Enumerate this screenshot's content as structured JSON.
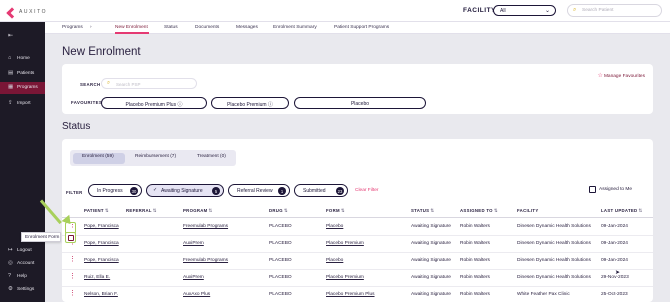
{
  "app": {
    "logo_text": "AUXITO"
  },
  "header": {
    "facility_label": "FACILITY",
    "facility_value": "All",
    "search_placeholder": "Search Patient"
  },
  "sidebar": {
    "items": [
      {
        "label": "Home",
        "icon": "home-icon"
      },
      {
        "label": "Patients",
        "icon": "patients-icon"
      },
      {
        "label": "Programs",
        "icon": "programs-icon",
        "active": true
      },
      {
        "label": "Import",
        "icon": "import-icon"
      },
      {
        "label": "Logout",
        "icon": "logout-icon"
      },
      {
        "label": "Account",
        "icon": "account-icon"
      },
      {
        "label": "Help",
        "icon": "help-icon"
      },
      {
        "label": "Settings",
        "icon": "settings-icon"
      }
    ]
  },
  "subnav": {
    "tabs": [
      "Programs",
      "New Enrolment",
      "Status",
      "Documents",
      "Messages",
      "Enrolment Summary",
      "Patient Support Programs"
    ],
    "active": "New Enrolment"
  },
  "new_enrolment": {
    "title": "New Enrolment",
    "manage_favourites": "Manage Favourites",
    "search_label": "SEARCH",
    "search_placeholder": "Search PSP",
    "favourites_label": "FAVOURITES",
    "favourites": [
      "Placebo Premium Plus",
      "Placebo Premium",
      "Placebo"
    ]
  },
  "status": {
    "title": "Status",
    "segments": [
      "Enrolment (59)",
      "Reimbursement (7)",
      "Treatment (0)"
    ],
    "filter_label": "FILTER",
    "filters": [
      {
        "label": "In Progress",
        "count": "30",
        "selected": false
      },
      {
        "label": "Awaiting Signature",
        "count": "5",
        "selected": true
      },
      {
        "label": "Referral Review",
        "count": "1",
        "selected": false
      },
      {
        "label": "Submitted",
        "count": "23",
        "selected": false
      }
    ],
    "clear_filter": "Clear Filter",
    "assigned_to_me": "Assigned to Me",
    "columns": [
      "PATIENT",
      "REFERRAL",
      "PROGRAM",
      "DRUG",
      "FORM",
      "STATUS",
      "ASSIGNED TO",
      "FACILITY",
      "LAST UPDATED"
    ],
    "rows": [
      {
        "patient": "Pope, Francisca",
        "referral": "",
        "program": "Freemulab Programs",
        "drug": "PLACEBO",
        "form": "Placebo",
        "status": "Awaiting Signature",
        "assigned_to": "Robin Walters",
        "facility": "Dinesen Dynamic Health Solutions",
        "updated": "09-Jan-2024"
      },
      {
        "patient": "Pope, Francisca",
        "referral": "",
        "program": "AuxiPrem",
        "drug": "PLACEBO",
        "form": "Placebo Premium",
        "status": "Awaiting Signature",
        "assigned_to": "Robin Walters",
        "facility": "Dinesen Dynamic Health Solutions",
        "updated": "09-Jan-2024"
      },
      {
        "patient": "Pope, Francisca",
        "referral": "",
        "program": "Freemulab Programs",
        "drug": "PLACEBO",
        "form": "Placebo",
        "status": "Awaiting Signature",
        "assigned_to": "Robin Walters",
        "facility": "Dinesen Dynamic Health Solutions",
        "updated": "09-Jan-2024"
      },
      {
        "patient": "Ruiz, Ella E.",
        "referral": "",
        "program": "AuxiPrem",
        "drug": "PLACEBO",
        "form": "Placebo Premium",
        "status": "Awaiting Signature",
        "assigned_to": "Robin Walters",
        "facility": "Dinesen Dynamic Health Solutions",
        "updated": "29-Nov-2023"
      },
      {
        "patient": "Nelson, Brian F.",
        "referral": "",
        "program": "AuxAxo Plus",
        "drug": "PLACEBO",
        "form": "Placebo Premium Plus",
        "status": "Awaiting Signature",
        "assigned_to": "Robin Walters",
        "facility": "White Feather Pax Clinic",
        "updated": "25-Oct-2023"
      }
    ]
  },
  "tooltip": {
    "text": "Enrolment Form"
  },
  "colors": {
    "accent": "#e53a73",
    "brand": "#7a1636",
    "sidebar": "#1d1a26",
    "highlight": "#a8d05b"
  }
}
